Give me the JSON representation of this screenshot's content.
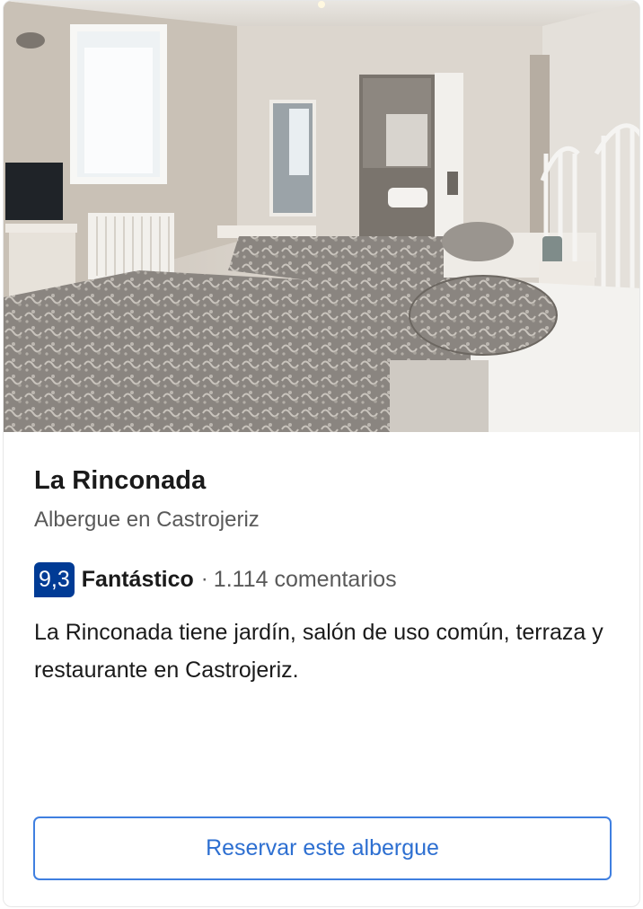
{
  "listing": {
    "name": "La Rinconada",
    "type_location": "Albergue en Castrojeriz",
    "rating": {
      "score": "9,3",
      "label": "Fantástico",
      "separator": "·",
      "reviews": "1.114 comentarios"
    },
    "description": "La Rinconada tiene jardín, salón de uso común, terraza y restaurante en Castrojeriz.",
    "book_label": "Reservar este albergue"
  },
  "colors": {
    "badge": "#003b95",
    "cta_border": "#3f7fe0",
    "cta_text": "#2d6fd1",
    "muted_text": "#595959"
  }
}
